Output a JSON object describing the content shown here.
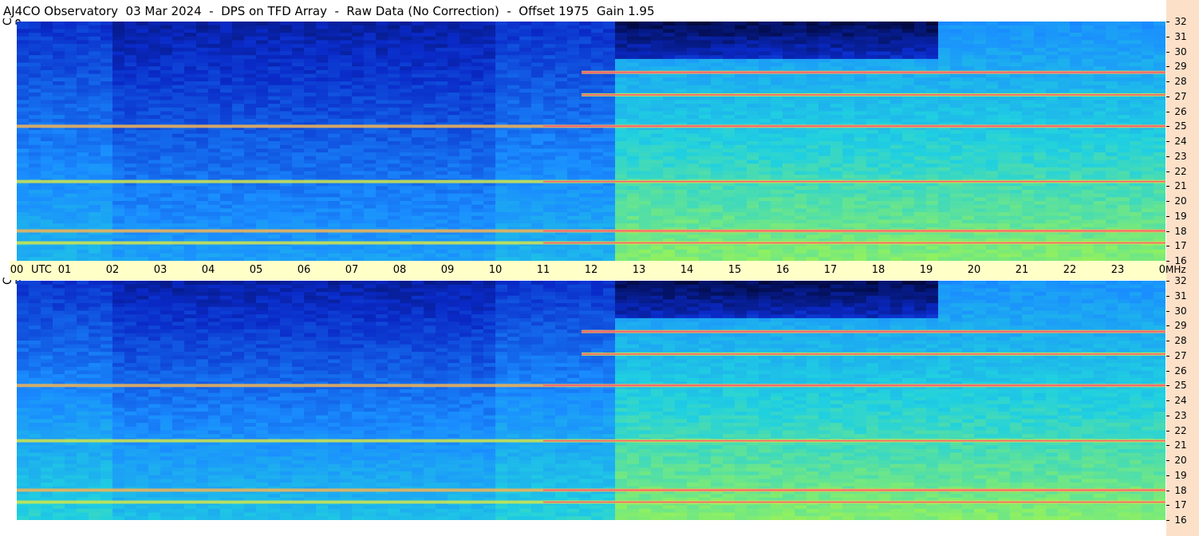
{
  "title": "AJ4CO Observatory  03 Mar 2024  -  DPS on TFD Array  -  Raw Data (No Correction)  -  Offset 1975  Gain 1.95",
  "panels": [
    {
      "id": "rcp",
      "label": "R C P"
    },
    {
      "id": "lcp",
      "label": "L C P"
    }
  ],
  "chart_data": {
    "type": "heatmap",
    "title": "AJ4CO Observatory  03 Mar 2024  -  DPS on TFD Array  -  Raw Data (No Correction)  -  Offset 1975  Gain 1.95",
    "x_ticks": [
      "00",
      "01",
      "02",
      "03",
      "04",
      "05",
      "06",
      "07",
      "08",
      "09",
      "10",
      "11",
      "12",
      "13",
      "14",
      "15",
      "16",
      "17",
      "18",
      "19",
      "20",
      "21",
      "22",
      "23",
      "00"
    ],
    "x_unit": "UTC",
    "xlim": [
      0,
      24
    ],
    "y_ticks": [
      16,
      17,
      18,
      19,
      20,
      21,
      22,
      23,
      24,
      25,
      26,
      27,
      28,
      29,
      30,
      31,
      32
    ],
    "y_unit": "MHz",
    "ylim": [
      16,
      32
    ],
    "colormap": [
      "#000018",
      "#0a2ac8",
      "#1a8cff",
      "#20d0e0",
      "#90f060",
      "#f0e040",
      "#ff4080"
    ],
    "series": [
      {
        "name": "R C P",
        "bands_mhz": [
          17.2,
          18.0,
          21.3,
          25.0,
          27.1,
          28.6
        ],
        "quiet_dark_hours": [
          12.6,
          19.2
        ],
        "quiet_dark_above_mhz": 29.5
      },
      {
        "name": "L C P",
        "bands_mhz": [
          17.2,
          18.0,
          21.3,
          25.0,
          27.1,
          28.6
        ],
        "quiet_dark_hours": [
          12.6,
          19.2
        ],
        "quiet_dark_above_mhz": 29.5
      }
    ]
  }
}
